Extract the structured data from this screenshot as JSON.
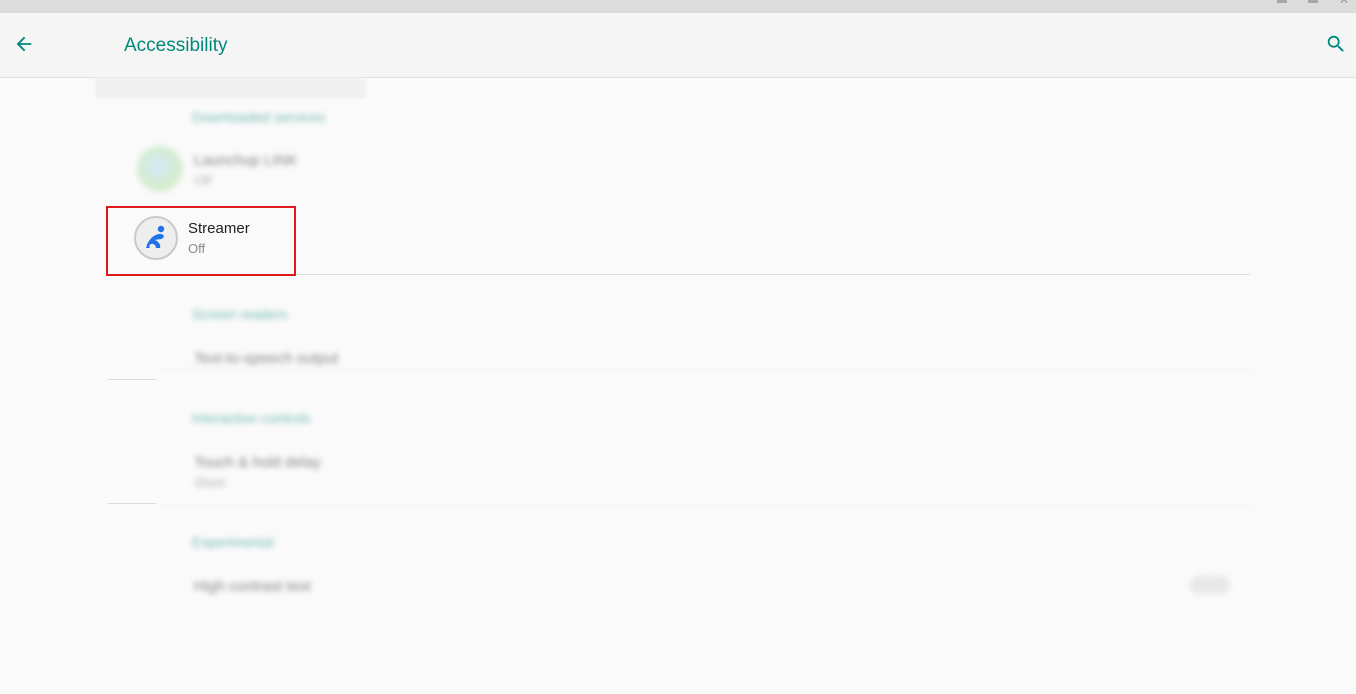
{
  "window": {
    "close_glyph": "✕"
  },
  "toolbar": {
    "title": "Accessibility",
    "back_icon": "arrow-back-icon",
    "search_icon": "search-icon",
    "accent_color": "#00897b"
  },
  "sections": [
    {
      "header": "Downloaded services",
      "items": [
        {
          "title": "Launchup LINK",
          "summary": "Off"
        },
        {
          "title": "Streamer",
          "summary": "Off",
          "highlighted": true
        }
      ]
    },
    {
      "header": "Screen readers",
      "items": [
        {
          "title": "Text-to-speech output"
        }
      ]
    },
    {
      "header": "Interaction controls",
      "items": [
        {
          "title": "Touch & hold delay",
          "summary": "Short"
        }
      ]
    },
    {
      "header": "Experimental",
      "items": [
        {
          "title": "High contrast text",
          "toggle": "off"
        }
      ]
    }
  ],
  "highlight_color": "#e0191f"
}
